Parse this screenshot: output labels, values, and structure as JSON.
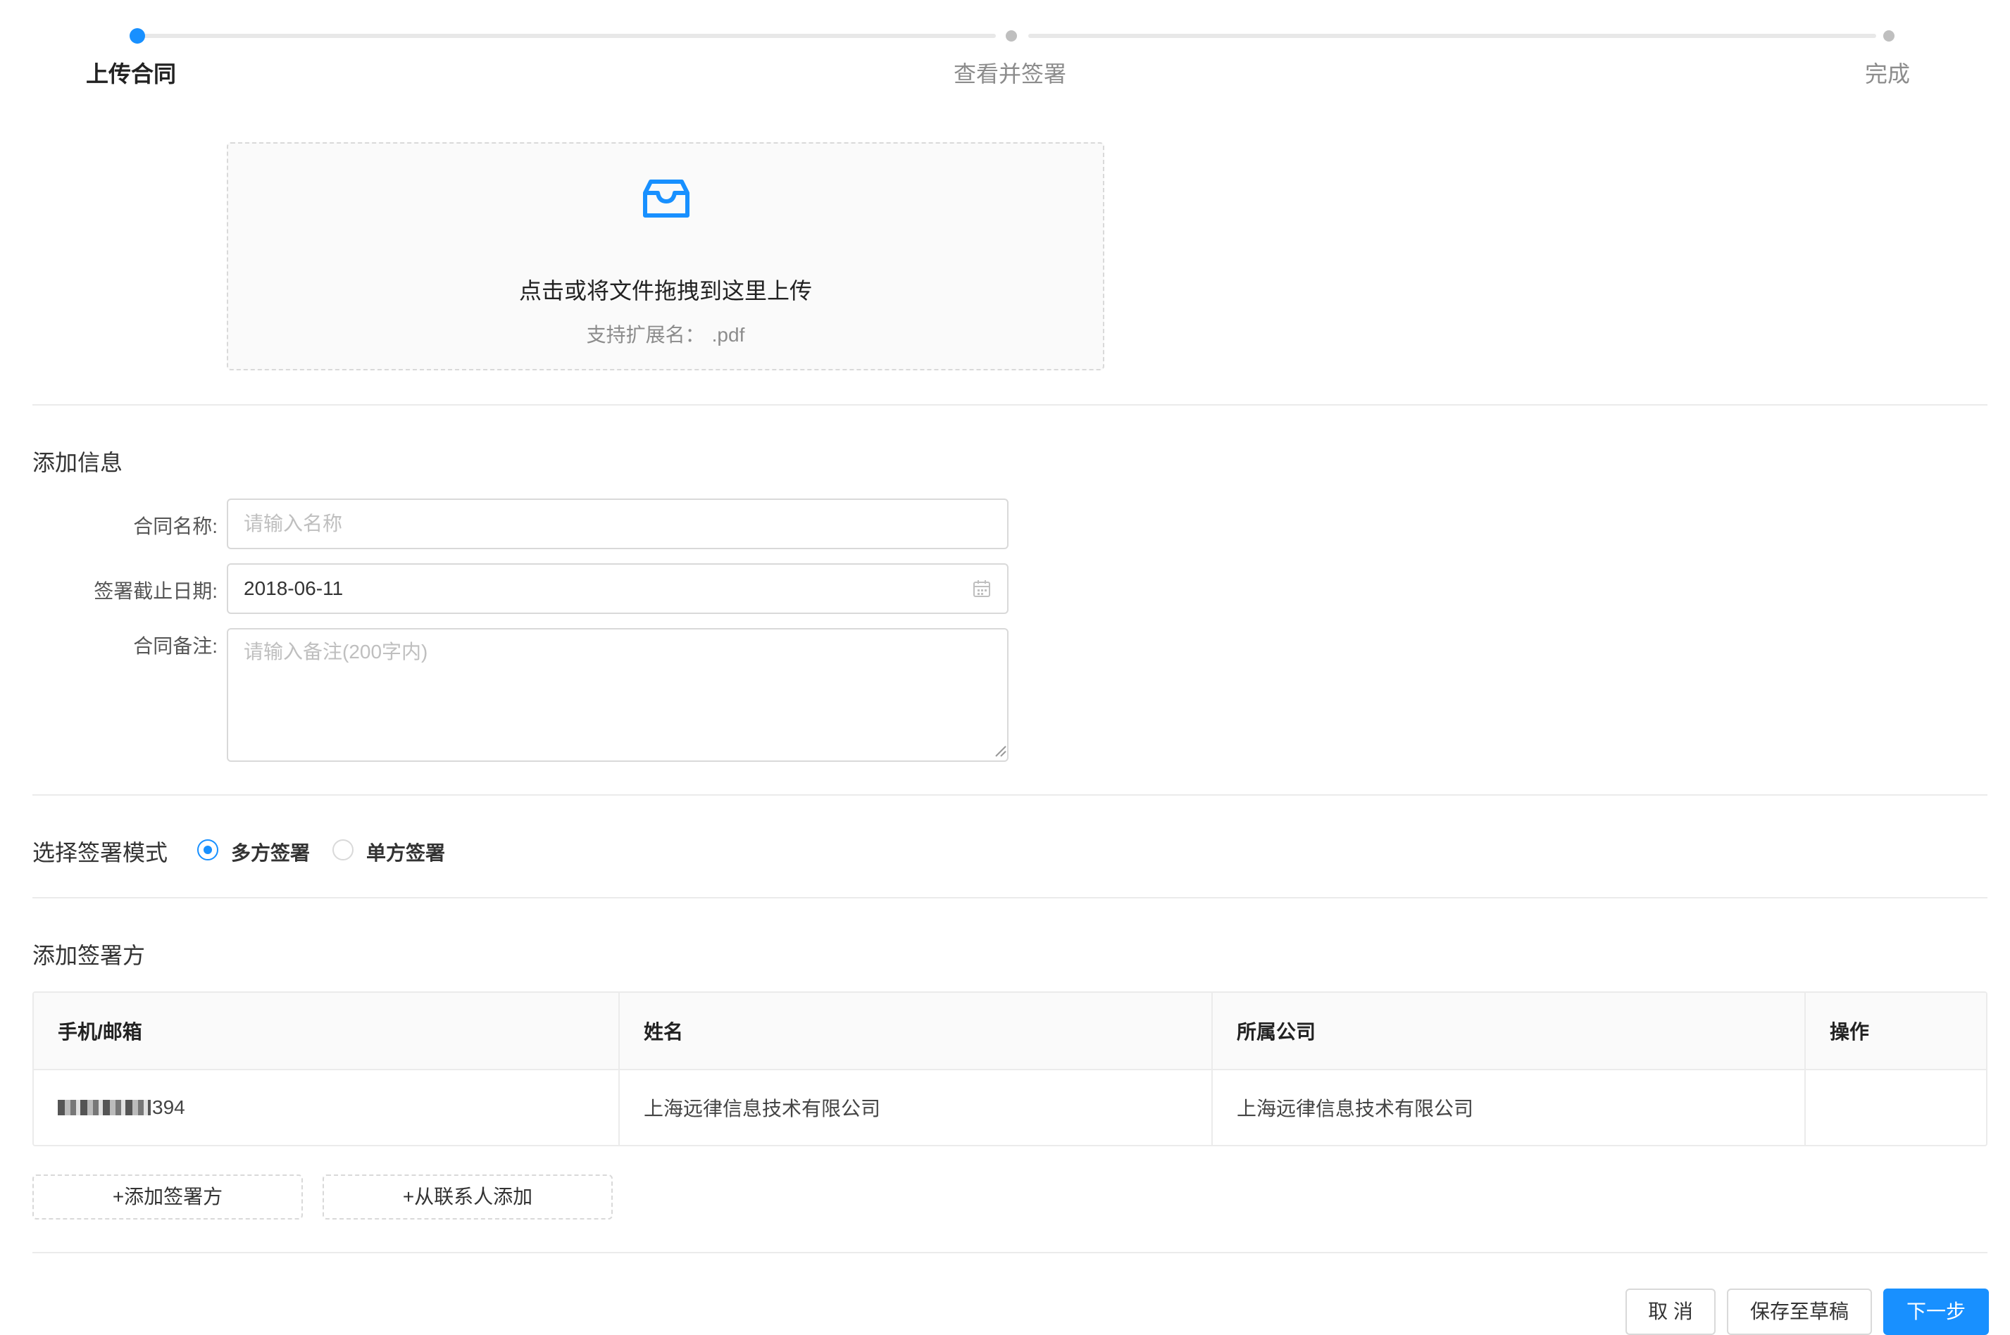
{
  "steps": [
    {
      "label": "上传合同",
      "state": "active"
    },
    {
      "label": "查看并签署",
      "state": "pending"
    },
    {
      "label": "完成",
      "state": "pending"
    }
  ],
  "upload": {
    "icon": "inbox-icon",
    "text": "点击或将文件拖拽到这里上传",
    "hint_label": "支持扩展名：",
    "hint_ext": ".pdf"
  },
  "info": {
    "title": "添加信息",
    "name_label": "合同名称:",
    "name_placeholder": "请输入名称",
    "date_label": "签署截止日期:",
    "date_value": "2018-06-11",
    "note_label": "合同备注:",
    "note_placeholder": "请输入备注(200字内)"
  },
  "mode": {
    "title": "选择签署模式",
    "options": [
      {
        "label": "多方签署",
        "checked": true
      },
      {
        "label": "单方签署",
        "checked": false
      }
    ]
  },
  "signers": {
    "title": "添加签署方",
    "columns": [
      "手机/邮箱",
      "姓名",
      "所属公司",
      "操作"
    ],
    "rows": [
      {
        "contact_suffix": "394",
        "name": "上海远律信息技术有限公司",
        "company": "上海远律信息技术有限公司",
        "action": ""
      }
    ],
    "add_button": "+添加签署方",
    "add_contact_button": "+从联系人添加"
  },
  "footer": {
    "cancel": "取 消",
    "save_draft": "保存至草稿",
    "next": "下一步"
  },
  "colors": {
    "primary": "#1890ff",
    "border": "#d9d9d9",
    "muted": "#8c8c8c"
  }
}
